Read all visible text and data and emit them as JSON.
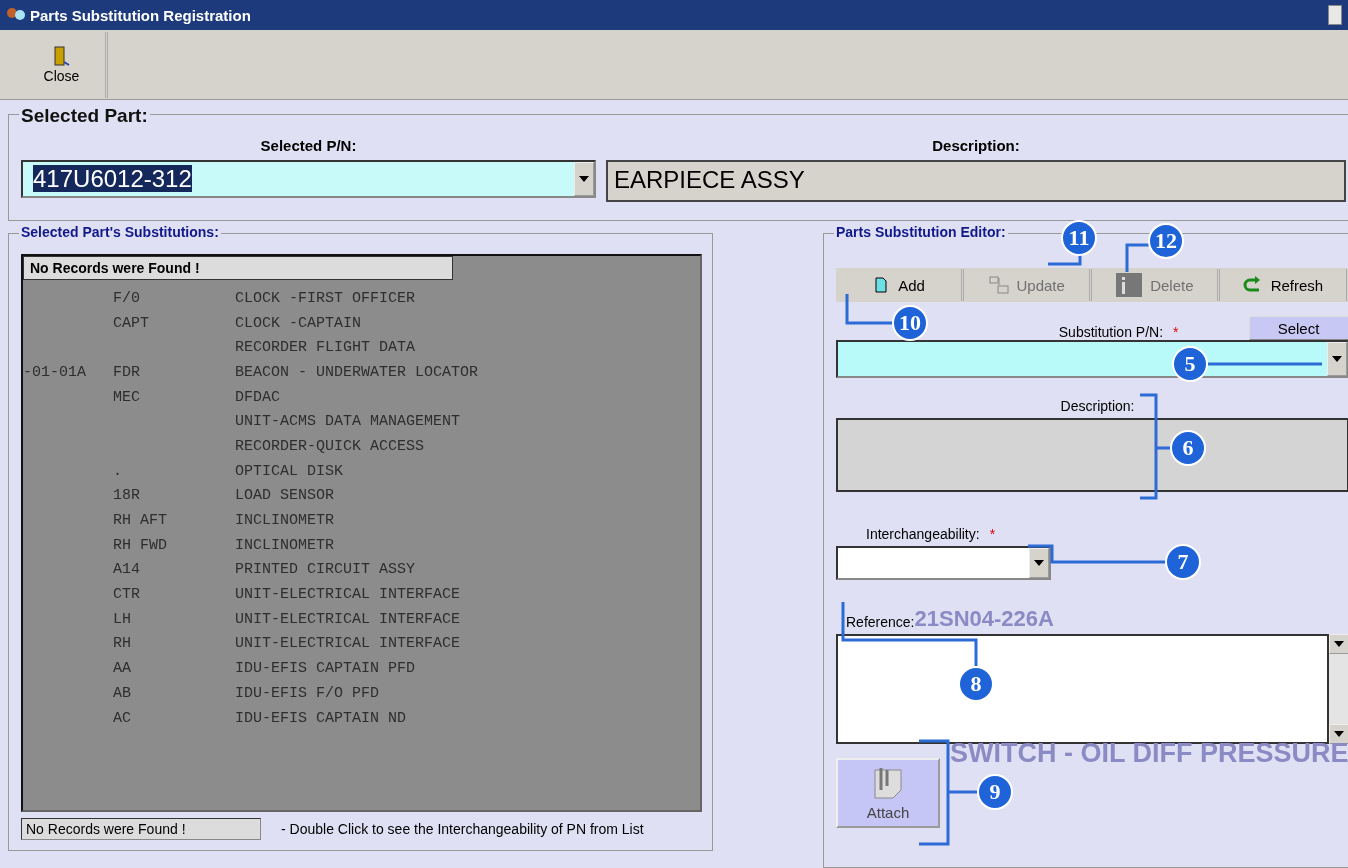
{
  "window": {
    "title": "Parts Substitution Registration"
  },
  "toolbar": {
    "close": "Close"
  },
  "selected_part": {
    "title": "Selected Part:",
    "pn_label": "Selected P/N:",
    "pn_value": "417U6012-312",
    "description_label": "Description:",
    "description_value": "EARPIECE ASSY"
  },
  "substitutions": {
    "title": "Selected Part's Substitutions:",
    "grid_message": "No Records were Found !",
    "status": "No Records were Found !",
    "hint": "-  Double Click to see the  Interchangeability of PN from List",
    "background_rows": [
      {
        "column_1": "",
        "column_2": "F/0",
        "column_3": "CLOCK -FIRST OFFICER"
      },
      {
        "column_1": "",
        "column_2": "CAPT",
        "column_3": "CLOCK -CAPTAIN"
      },
      {
        "column_1": "",
        "column_2": "",
        "column_3": "RECORDER FLIGHT DATA"
      },
      {
        "column_1": "-01-01A",
        "column_2": "FDR",
        "column_3": "BEACON - UNDERWATER LOCATOR"
      },
      {
        "column_1": "",
        "column_2": "MEC",
        "column_3": "DFDAC"
      },
      {
        "column_1": "",
        "column_2": "",
        "column_3": "UNIT-ACMS DATA MANAGEMENT"
      },
      {
        "column_1": "",
        "column_2": "",
        "column_3": "RECORDER-QUICK ACCESS"
      },
      {
        "column_1": "",
        "column_2": ".",
        "column_3": "OPTICAL DISK"
      },
      {
        "column_1": "",
        "column_2": "18R",
        "column_3": "LOAD SENSOR"
      },
      {
        "column_1": "",
        "column_2": "RH AFT",
        "column_3": "INCLINOMETR"
      },
      {
        "column_1": "",
        "column_2": "RH FWD",
        "column_3": "INCLINOMETR"
      },
      {
        "column_1": "",
        "column_2": "A14",
        "column_3": "PRINTED CIRCUIT ASSY"
      },
      {
        "column_1": "",
        "column_2": "CTR",
        "column_3": "UNIT-ELECTRICAL INTERFACE"
      },
      {
        "column_1": "",
        "column_2": "LH",
        "column_3": "UNIT-ELECTRICAL INTERFACE"
      },
      {
        "column_1": "",
        "column_2": "RH",
        "column_3": "UNIT-ELECTRICAL INTERFACE"
      },
      {
        "column_1": "",
        "column_2": "AA",
        "column_3": "IDU-EFIS CAPTAIN PFD"
      },
      {
        "column_1": "",
        "column_2": "AB",
        "column_3": "IDU-EFIS F/O PFD"
      },
      {
        "column_1": "",
        "column_2": "AC",
        "column_3": "IDU-EFIS CAPTAIN ND"
      }
    ]
  },
  "editor": {
    "title": "Parts Substitution Editor:",
    "buttons": [
      {
        "kind": "add",
        "label": "Add",
        "disabled": false
      },
      {
        "kind": "update",
        "label": "Update",
        "disabled": true
      },
      {
        "kind": "delete",
        "label": "Delete",
        "disabled": true
      },
      {
        "kind": "refresh",
        "label": "Refresh",
        "disabled": false
      }
    ],
    "substitution_label": "Substitution P/N:",
    "required_mark": "*",
    "select_button": "Select",
    "description_label": "Description:",
    "interchangeability_label": "Interchangeability:",
    "interchangeability_required": "*",
    "reference_label": "Reference:",
    "attach_button": "Attach"
  },
  "background_window": {
    "reference_pn": "21SN04-226A",
    "description": "SWITCH - OIL DIFF PRESSURE"
  },
  "callouts": [
    "5",
    "6",
    "7",
    "8",
    "9",
    "10",
    "11",
    "12"
  ]
}
